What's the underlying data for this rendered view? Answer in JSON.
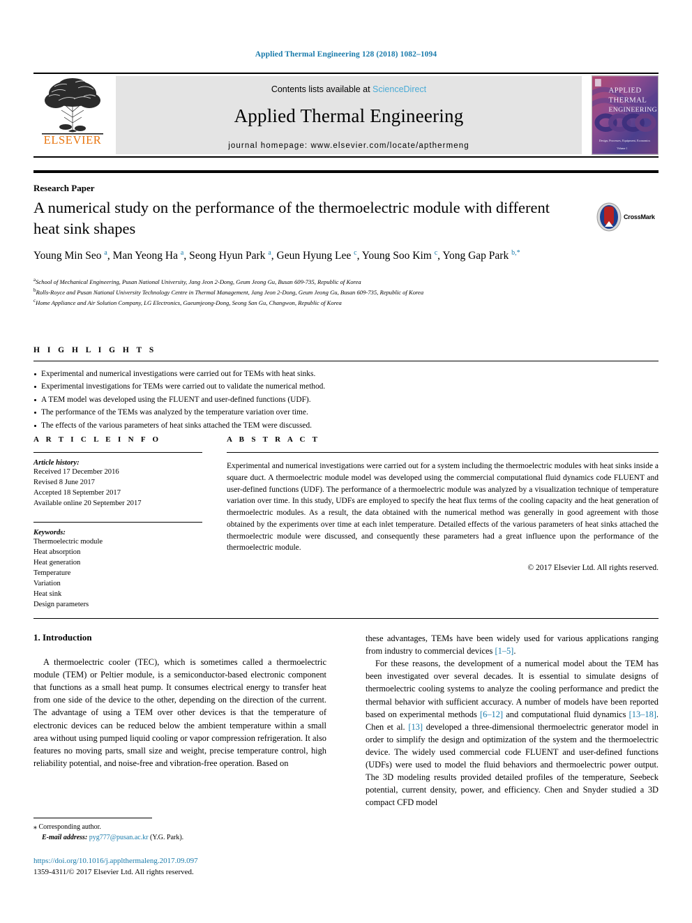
{
  "running_head": "Applied Thermal Engineering 128 (2018) 1082–1094",
  "masthead": {
    "contents_prefix": "Contents lists available at ",
    "contents_link": "ScienceDirect",
    "journal_title": "Applied Thermal Engineering",
    "homepage": "journal homepage: www.elsevier.com/locate/apthermeng",
    "publisher_name": "ELSEVIER",
    "cover_title_lines": [
      "APPLIED",
      "THERMAL",
      "ENGINEERING"
    ],
    "cover_footer": "Design, Processes, Equipment, Economics",
    "cover_volume": "Volume 1"
  },
  "article": {
    "type": "Research Paper",
    "title": "A numerical study on the performance of the thermoelectric module with different heat sink shapes",
    "crossmark_label": "CrossMark",
    "authors_html": "Young Min Seo <sup>a</sup>, Man Yeong Ha <sup>a</sup>, Seong Hyun Park <sup>a</sup>, Geun Hyung Lee <sup>c</sup>, Young Soo Kim <sup>c</sup>, Yong Gap Park <sup>b,*</sup>",
    "affiliations": [
      "School of Mechanical Engineering, Pusan National University, Jang Jeon 2-Dong, Geum Jeong Gu, Busan 609-735, Republic of Korea",
      "Rolls-Royce and Pusan National University Technology Centre in Thermal Management, Jang Jeon 2-Dong, Geum Jeong Gu, Busan 609-735, Republic of Korea",
      "Home Appliance and Air Solution Company, LG Electronics, Gaeumjeong-Dong, Seong San Gu, Changwon, Republic of Korea"
    ],
    "affiliation_markers": [
      "a",
      "b",
      "c"
    ]
  },
  "highlights": {
    "heading": "H I G H L I G H T S",
    "items": [
      "Experimental and numerical investigations were carried out for TEMs with heat sinks.",
      "Experimental investigations for TEMs were carried out to validate the numerical method.",
      "A TEM model was developed using the FLUENT and user-defined functions (UDF).",
      "The performance of the TEMs was analyzed by the temperature variation over time.",
      "The effects of the various parameters of heat sinks attached the TEM were discussed."
    ]
  },
  "article_info": {
    "heading": "A R T I C L E  I N F O",
    "history_label": "Article history:",
    "history": [
      "Received 17 December 2016",
      "Revised 8 June 2017",
      "Accepted 18 September 2017",
      "Available online 20 September 2017"
    ],
    "keywords_label": "Keywords:",
    "keywords": [
      "Thermoelectric module",
      "Heat absorption",
      "Heat generation",
      "Temperature",
      "Variation",
      "Heat sink",
      "Design parameters"
    ]
  },
  "abstract": {
    "heading": "A B S T R A C T",
    "text": "Experimental and numerical investigations were carried out for a system including the thermoelectric modules with heat sinks inside a square duct. A thermoelectric module model was developed using the commercial computational fluid dynamics code FLUENT and user-defined functions (UDF). The performance of a thermoelectric module was analyzed by a visualization technique of temperature variation over time. In this study, UDFs are employed to specify the heat flux terms of the cooling capacity and the heat generation of thermoelectric modules. As a result, the data obtained with the numerical method was generally in good agreement with those obtained by the experiments over time at each inlet temperature. Detailed effects of the various parameters of heat sinks attached the thermoelectric module were discussed, and consequently these parameters had a great influence upon the performance of the thermoelectric module.",
    "copyright": "© 2017 Elsevier Ltd. All rights reserved."
  },
  "body": {
    "section_title": "1. Introduction",
    "left_paragraphs": [
      "A thermoelectric cooler (TEC), which is sometimes called a thermoelectric module (TEM) or Peltier module, is a semiconductor-based electronic component that functions as a small heat pump. It consumes electrical energy to transfer heat from one side of the device to the other, depending on the direction of the current. The advantage of using a TEM over other devices is that the temperature of electronic devices can be reduced below the ambient temperature within a small area without using pumped liquid cooling or vapor compression refrigeration. It also features no moving parts, small size and weight, precise temperature control, high reliability potential, and noise-free and vibration-free operation. Based on"
    ],
    "right_paragraph_1_html": "these advantages, TEMs have been widely used for various applications ranging from industry to commercial devices <span class=\"ref\">[1–5]</span>.",
    "right_paragraph_2_html": "For these reasons, the development of a numerical model about the TEM has been investigated over several decades. It is essential to simulate designs of thermoelectric cooling systems to analyze the cooling performance and predict the thermal behavior with sufficient accuracy. A number of models have been reported based on experimental methods <span class=\"ref\">[6–12]</span> and computational fluid dynamics <span class=\"ref\">[13–18]</span>. Chen et al. <span class=\"ref\">[13]</span> developed a three-dimensional thermoelectric generator model in order to simplify the design and optimization of the system and the thermoelectric device. The widely used commercial code FLUENT and user-defined functions (UDFs) were used to model the fluid behaviors and thermoelectric power output. The 3D modeling results provided detailed profiles of the temperature, Seebeck potential, current density, power, and efficiency. Chen and Snyder studied a 3D compact CFD model"
  },
  "footer": {
    "corresponding_author": "Corresponding author.",
    "email_label": "E-mail address:",
    "email": "pyg777@pusan.ac.kr",
    "email_suffix": "(Y.G. Park).",
    "doi": "https://doi.org/10.1016/j.applthermaleng.2017.09.097",
    "issn_line": "1359-4311/© 2017 Elsevier Ltd. All rights reserved."
  },
  "colors": {
    "link": "#1a7bab",
    "sciencedirect": "#4aabd6",
    "elsevier_orange": "#e8730b",
    "band_gray": "#e4e4e4"
  }
}
